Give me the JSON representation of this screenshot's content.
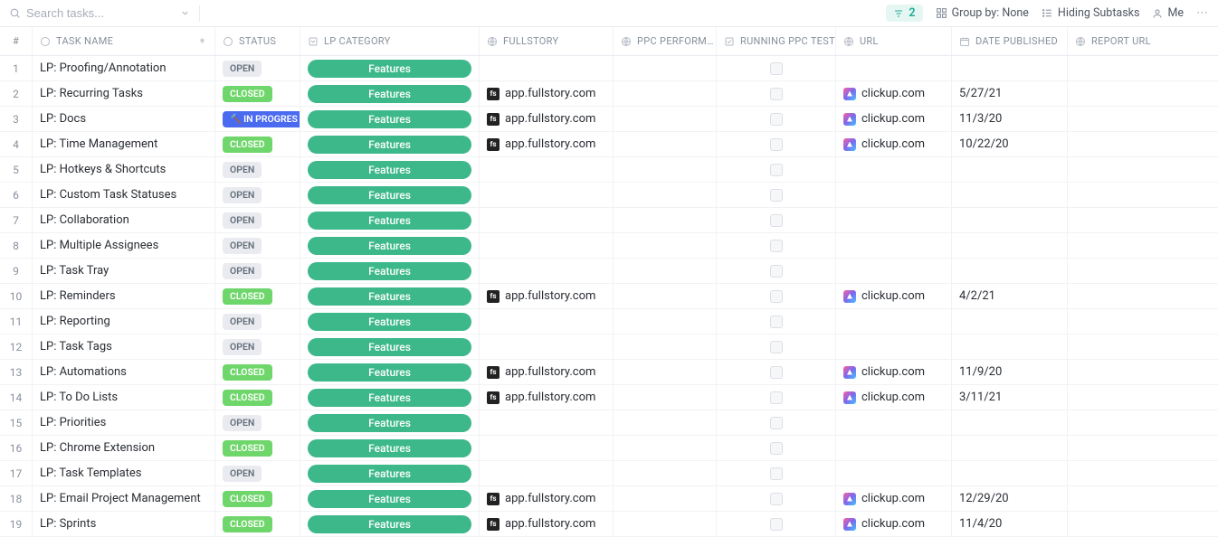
{
  "toolbar": {
    "search_placeholder": "Search tasks...",
    "filter_count": "2",
    "group_label": "Group by: None",
    "hiding_label": "Hiding Subtasks",
    "me_label": "Me"
  },
  "headers": {
    "num": "#",
    "task_name": "TASK NAME",
    "status": "STATUS",
    "lp_category": "LP CATEGORY",
    "fullstory": "FULLSTORY",
    "ppc_perf": "PPC PERFORM…",
    "running_ppc": "RUNNING PPC TESTS",
    "url": "URL",
    "date_published": "DATE PUBLISHED",
    "report_url": "REPORT URL"
  },
  "status_labels": {
    "open": "OPEN",
    "closed": "CLOSED",
    "in_progress": "IN PROGRES"
  },
  "category_label": "Features",
  "fullstory_text": "app.fullstory.com",
  "url_text": "clickup.com",
  "rows": [
    {
      "num": "1",
      "name": "LP: Proofing/Annotation",
      "status": "open",
      "full": false,
      "url": false,
      "date": ""
    },
    {
      "num": "2",
      "name": "LP: Recurring Tasks",
      "status": "closed",
      "full": true,
      "url": true,
      "date": "5/27/21"
    },
    {
      "num": "3",
      "name": "LP: Docs",
      "status": "in_progress",
      "full": true,
      "url": true,
      "date": "11/3/20"
    },
    {
      "num": "4",
      "name": "LP: Time Management",
      "status": "closed",
      "full": true,
      "url": true,
      "date": "10/22/20"
    },
    {
      "num": "5",
      "name": "LP: Hotkeys & Shortcuts",
      "status": "open",
      "full": false,
      "url": false,
      "date": ""
    },
    {
      "num": "6",
      "name": "LP: Custom Task Statuses",
      "status": "open",
      "full": false,
      "url": false,
      "date": ""
    },
    {
      "num": "7",
      "name": "LP: Collaboration",
      "status": "open",
      "full": false,
      "url": false,
      "date": ""
    },
    {
      "num": "8",
      "name": "LP: Multiple Assignees",
      "status": "open",
      "full": false,
      "url": false,
      "date": ""
    },
    {
      "num": "9",
      "name": "LP: Task Tray",
      "status": "open",
      "full": false,
      "url": false,
      "date": ""
    },
    {
      "num": "10",
      "name": "LP: Reminders",
      "status": "closed",
      "full": true,
      "url": true,
      "date": "4/2/21"
    },
    {
      "num": "11",
      "name": "LP: Reporting",
      "status": "open",
      "full": false,
      "url": false,
      "date": ""
    },
    {
      "num": "12",
      "name": "LP: Task Tags",
      "status": "open",
      "full": false,
      "url": false,
      "date": ""
    },
    {
      "num": "13",
      "name": "LP: Automations",
      "status": "closed",
      "full": true,
      "url": true,
      "date": "11/9/20"
    },
    {
      "num": "14",
      "name": "LP: To Do Lists",
      "status": "closed",
      "full": true,
      "url": true,
      "date": "3/11/21"
    },
    {
      "num": "15",
      "name": "LP: Priorities",
      "status": "open",
      "full": false,
      "url": false,
      "date": ""
    },
    {
      "num": "16",
      "name": "LP: Chrome Extension",
      "status": "closed",
      "full": false,
      "url": false,
      "date": ""
    },
    {
      "num": "17",
      "name": "LP: Task Templates",
      "status": "open",
      "full": false,
      "url": false,
      "date": ""
    },
    {
      "num": "18",
      "name": "LP: Email Project Management",
      "status": "closed",
      "full": true,
      "url": true,
      "date": "12/29/20"
    },
    {
      "num": "19",
      "name": "LP: Sprints",
      "status": "closed",
      "full": true,
      "url": true,
      "date": "11/4/20"
    }
  ]
}
